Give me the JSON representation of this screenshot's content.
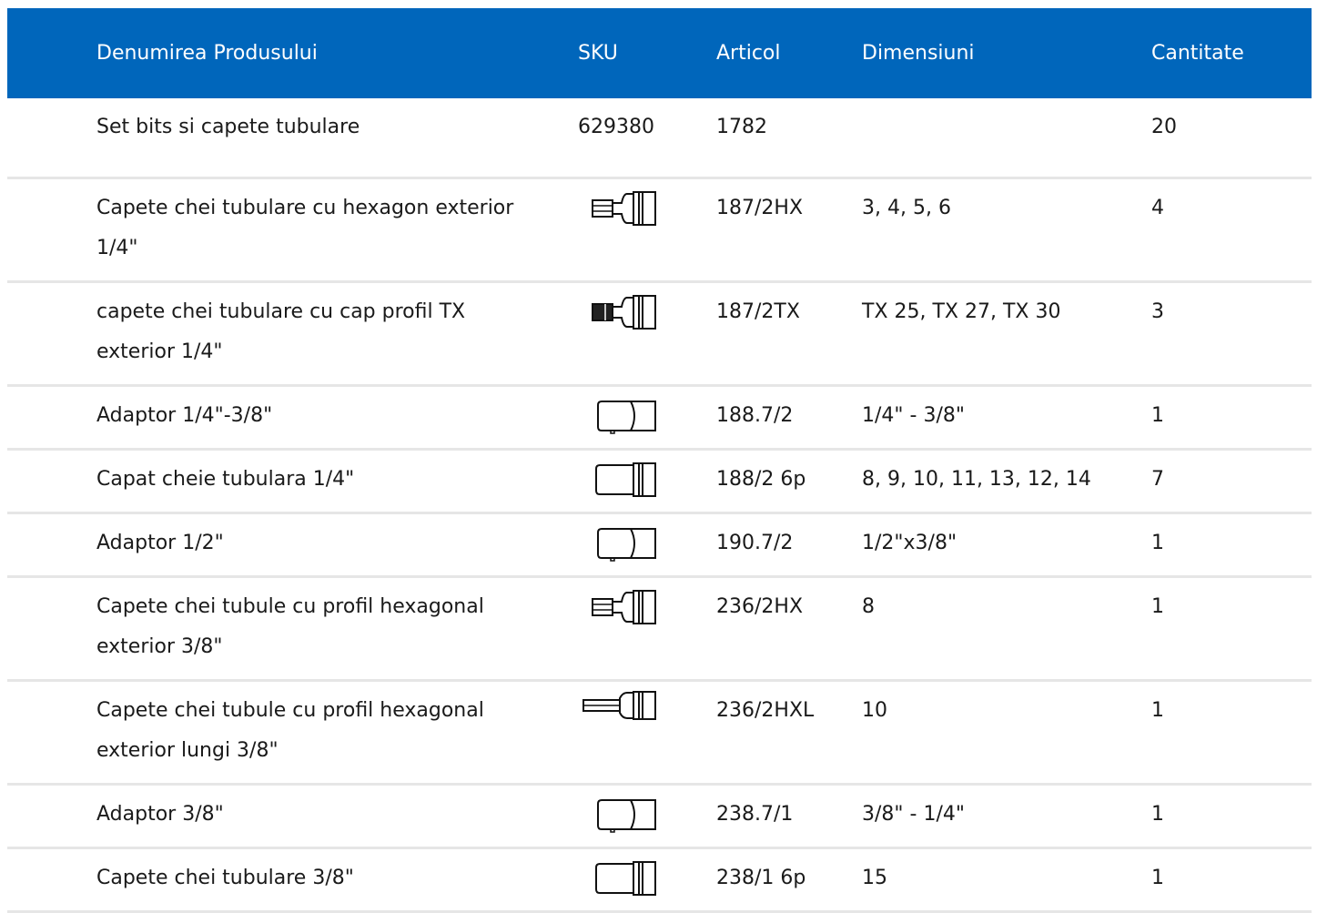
{
  "table": {
    "headers": {
      "name": "Denumirea Produsului",
      "sku": "SKU",
      "article": "Articol",
      "dimensions": "Dimensiuni",
      "quantity": "Cantitate"
    },
    "rows": [
      {
        "name": "Set bits si capete tubulare",
        "sku": "629380",
        "sku_icon": null,
        "article": "1782",
        "dimensions": "",
        "quantity": "20"
      },
      {
        "name": "Capete chei tubulare cu hexagon exterior 1/4\"",
        "sku": "",
        "sku_icon": "hex-bit-socket-icon",
        "article": "187/2HX",
        "dimensions": "3, 4, 5, 6",
        "quantity": "4"
      },
      {
        "name": "capete chei tubulare cu cap profil TX exterior 1/4\"",
        "sku": "",
        "sku_icon": "torx-bit-socket-icon",
        "article": "187/2TX",
        "dimensions": "TX 25, TX 27, TX 30",
        "quantity": "3"
      },
      {
        "name": "Adaptor 1/4\"-3/8\"",
        "sku": "",
        "sku_icon": "adaptor-icon",
        "article": "188.7/2",
        "dimensions": "1/4\" - 3/8\"",
        "quantity": "1"
      },
      {
        "name": "Capat cheie tubulara 1/4\"",
        "sku": "",
        "sku_icon": "socket-icon",
        "article": "188/2 6p",
        "dimensions": "8, 9, 10, 11, 13, 12, 14",
        "quantity": "7"
      },
      {
        "name": "Adaptor 1/2\"",
        "sku": "",
        "sku_icon": "adaptor-icon",
        "article": "190.7/2",
        "dimensions": "1/2\"x3/8\"",
        "quantity": "1"
      },
      {
        "name": "Capete chei tubule cu profil hexagonal exterior 3/8\"",
        "sku": "",
        "sku_icon": "hex-bit-socket-icon",
        "article": "236/2HX",
        "dimensions": "8",
        "quantity": "1"
      },
      {
        "name": "Capete chei tubule cu profil hexagonal exterior lungi 3/8\"",
        "sku": "",
        "sku_icon": "long-hex-bit-socket-icon",
        "article": "236/2HXL",
        "dimensions": "10",
        "quantity": "1"
      },
      {
        "name": "Adaptor 3/8\"",
        "sku": "",
        "sku_icon": "adaptor-icon",
        "article": "238.7/1",
        "dimensions": "3/8\" - 1/4\"",
        "quantity": "1"
      },
      {
        "name": "Capete chei tubulare 3/8\"",
        "sku": "",
        "sku_icon": "socket-icon",
        "article": "238/1 6p",
        "dimensions": "15",
        "quantity": "1"
      }
    ]
  }
}
